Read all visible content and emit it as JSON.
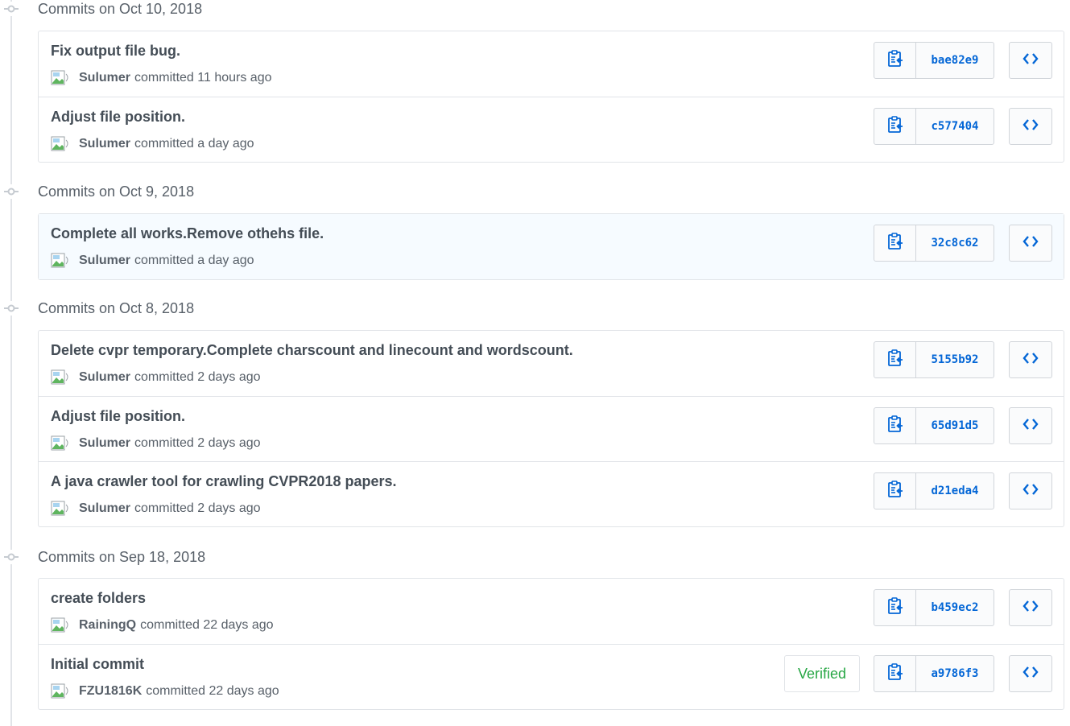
{
  "groups": [
    {
      "title": "Commits on Oct 10, 2018",
      "commits": [
        {
          "message": "Fix output file bug.",
          "author": "Sulumer",
          "action": "committed",
          "time": "11 hours ago",
          "sha": "bae82e9"
        },
        {
          "message": "Adjust file position.",
          "author": "Sulumer",
          "action": "committed",
          "time": "a day ago",
          "sha": "c577404"
        }
      ]
    },
    {
      "title": "Commits on Oct 9, 2018",
      "commits": [
        {
          "message": "Complete all works.Remove othehs file.",
          "author": "Sulumer",
          "action": "committed",
          "time": "a day ago",
          "sha": "32c8c62"
        }
      ]
    },
    {
      "title": "Commits on Oct 8, 2018",
      "commits": [
        {
          "message": "Delete cvpr temporary.Complete charscount and linecount and wordscount.",
          "author": "Sulumer",
          "action": "committed",
          "time": "2 days ago",
          "sha": "5155b92"
        },
        {
          "message": "Adjust file position.",
          "author": "Sulumer",
          "action": "committed",
          "time": "2 days ago",
          "sha": "65d91d5"
        },
        {
          "message": "A java crawler tool for crawling CVPR2018 papers.",
          "author": "Sulumer",
          "action": "committed",
          "time": "2 days ago",
          "sha": "d21eda4"
        }
      ]
    },
    {
      "title": "Commits on Sep 18, 2018",
      "commits": [
        {
          "message": "create folders",
          "author": "RainingQ",
          "action": "committed",
          "time": "22 days ago",
          "sha": "b459ec2"
        },
        {
          "message": "Initial commit",
          "author": "FZU1816K",
          "action": "committed",
          "time": "22 days ago",
          "sha": "a9786f3",
          "badge": "Verified"
        }
      ]
    }
  ],
  "icons": {
    "clipboard": "clippy-icon",
    "browse": "code-icon",
    "timeline": "git-commit-icon",
    "avatar": "broken-image-icon"
  },
  "colors": {
    "link": "#0366d6",
    "verified": "#28a745",
    "highlight_row": "#f6fbff"
  }
}
